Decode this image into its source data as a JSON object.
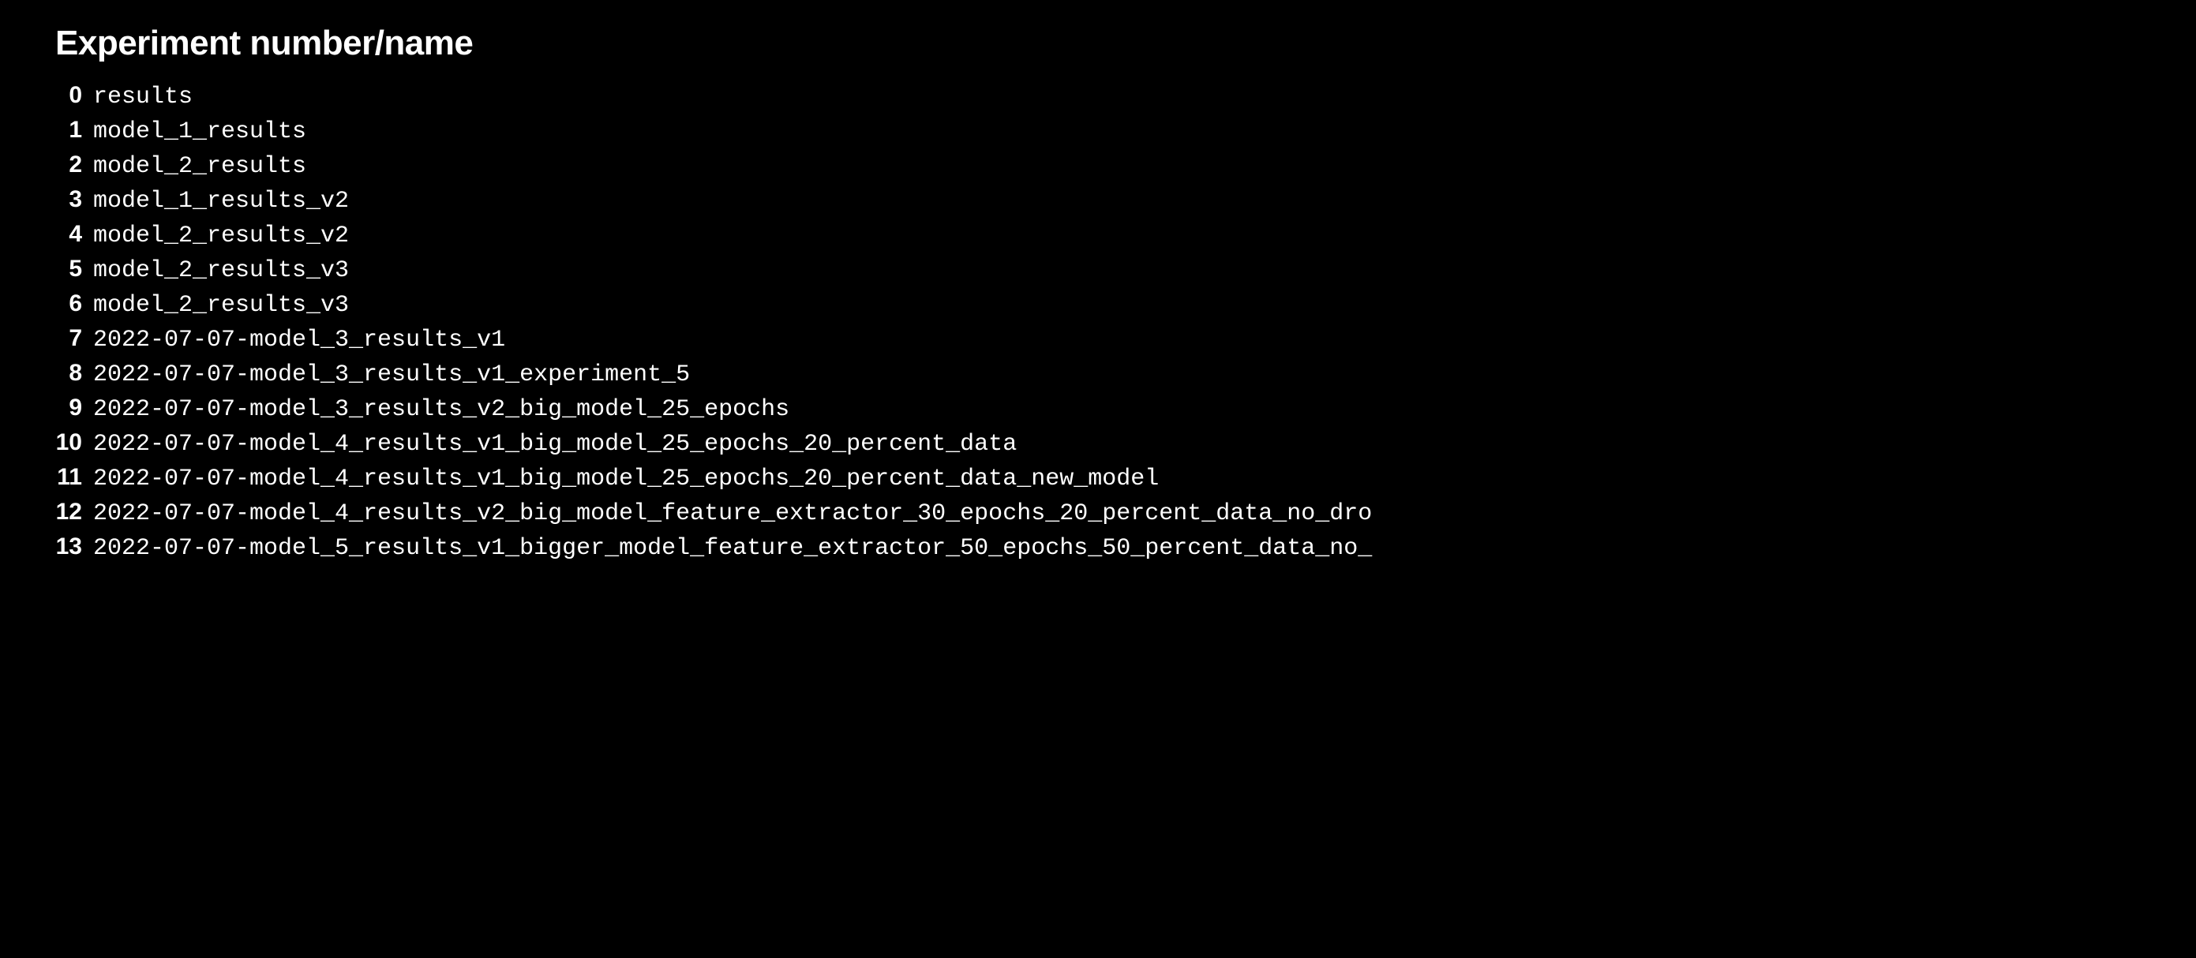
{
  "heading": "Experiment number/name",
  "rows": [
    {
      "num": "0",
      "name": "results"
    },
    {
      "num": "1",
      "name": "model_1_results"
    },
    {
      "num": "2",
      "name": "model_2_results"
    },
    {
      "num": "3",
      "name": "model_1_results_v2"
    },
    {
      "num": "4",
      "name": "model_2_results_v2"
    },
    {
      "num": "5",
      "name": "model_2_results_v3"
    },
    {
      "num": "6",
      "name": "model_2_results_v3"
    },
    {
      "num": "7",
      "name": "2022-07-07-model_3_results_v1"
    },
    {
      "num": "8",
      "name": "2022-07-07-model_3_results_v1_experiment_5"
    },
    {
      "num": "9",
      "name": "2022-07-07-model_3_results_v2_big_model_25_epochs"
    },
    {
      "num": "10",
      "name": "2022-07-07-model_4_results_v1_big_model_25_epochs_20_percent_data"
    },
    {
      "num": "11",
      "name": "2022-07-07-model_4_results_v1_big_model_25_epochs_20_percent_data_new_model"
    },
    {
      "num": "12",
      "name": "2022-07-07-model_4_results_v2_big_model_feature_extractor_30_epochs_20_percent_data_no_dro"
    },
    {
      "num": "13",
      "name": "2022-07-07-model_5_results_v1_bigger_model_feature_extractor_50_epochs_50_percent_data_no_"
    }
  ]
}
